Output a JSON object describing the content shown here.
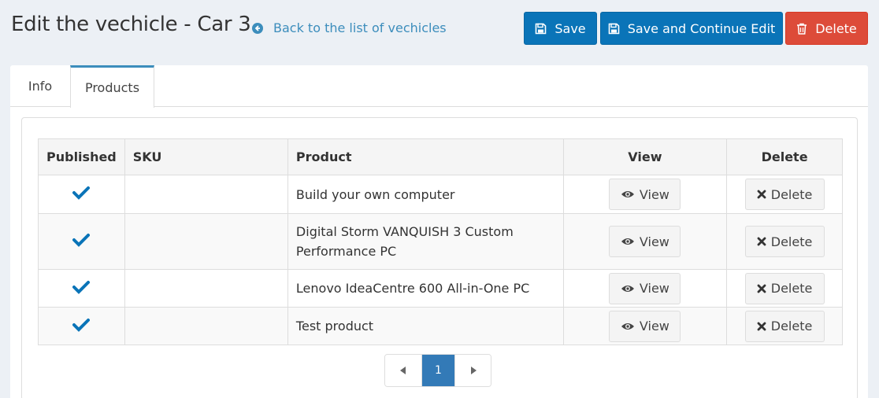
{
  "header": {
    "title": "Edit the vechicle - Car 3",
    "back_link": "Back to the list of vechicles",
    "save_label": "Save",
    "save_continue_label": "Save and Continue Edit",
    "delete_label": "Delete"
  },
  "tabs": [
    {
      "label": "Info",
      "active": false
    },
    {
      "label": "Products",
      "active": true
    }
  ],
  "table": {
    "columns": [
      "Published",
      "SKU",
      "Product",
      "View",
      "Delete"
    ],
    "rows": [
      {
        "published": true,
        "sku": "",
        "product": "Build your own computer",
        "view_label": "View",
        "delete_label": "Delete"
      },
      {
        "published": true,
        "sku": "",
        "product": "Digital Storm VANQUISH 3 Custom Performance PC",
        "view_label": "View",
        "delete_label": "Delete"
      },
      {
        "published": true,
        "sku": "",
        "product": "Lenovo IdeaCentre 600 All-in-One PC",
        "view_label": "View",
        "delete_label": "Delete"
      },
      {
        "published": true,
        "sku": "",
        "product": "Test product",
        "view_label": "View",
        "delete_label": "Delete"
      }
    ]
  },
  "pager": {
    "current_page": "1"
  },
  "colors": {
    "primary": "#0a74b8",
    "danger": "#dd4b39",
    "link": "#3c8dbc",
    "check": "#0a74b8"
  },
  "icons": {
    "back": "arrow-circle-left-icon",
    "save": "floppy-disk-icon",
    "delete": "trash-icon",
    "published": "checkmark-icon",
    "view": "eye-icon",
    "row_delete": "x-icon",
    "prev": "triangle-left-icon",
    "next": "triangle-right-icon"
  }
}
